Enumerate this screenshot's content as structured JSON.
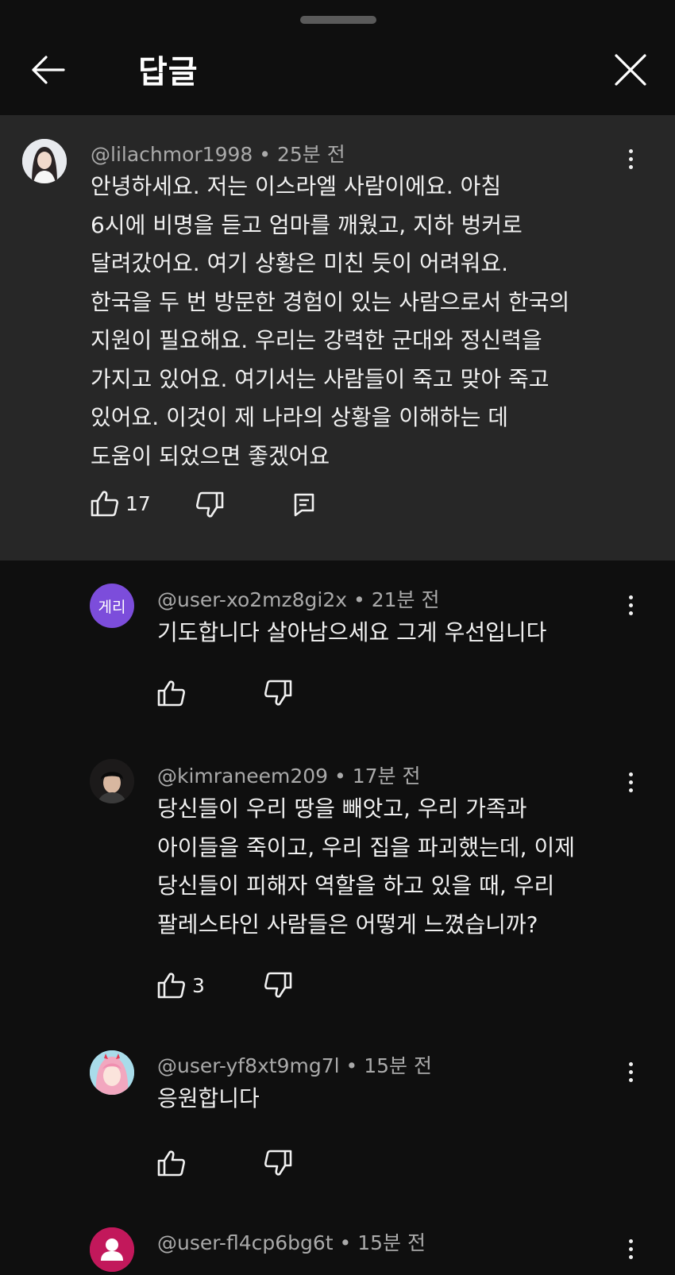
{
  "header": {
    "title": "답글",
    "back_icon": "arrow-left-icon",
    "close_icon": "close-icon"
  },
  "parent_comment": {
    "author": "@lilachmor1998",
    "time": "• 25분 전",
    "text": "안녕하세요. 저는 이스라엘 사람이에요. 아침\n6시에 비명을 듣고 엄마를 깨웠고, 지하 벙커로\n달려갔어요. 여기 상황은 미친 듯이 어려워요.\n한국을 두 번 방문한 경험이 있는 사람으로서 한국의\n지원이 필요해요. 우리는 강력한 군대와 정신력을\n가지고 있어요. 여기서는 사람들이 죽고 맞아 죽고\n있어요. 이것이 제 나라의 상황을 이해하는 데\n도움이 되었으면 좋겠어요",
    "likes": "17"
  },
  "replies": [
    {
      "author": "@user-xo2mz8gi2x",
      "time": "• 21분 전",
      "avatar_text": "게리",
      "avatar_color": "#7c4ddb",
      "text": "기도합니다 살아남으세요 그게 우선입니다",
      "likes": ""
    },
    {
      "author": "@kimraneem209",
      "time": "• 17분 전",
      "avatar_text": "",
      "text": "당신들이 우리 땅을 빼앗고, 우리 가족과\n아이들을 죽이고, 우리 집을 파괴했는데, 이제\n당신들이 피해자 역할을 하고 있을 때, 우리\n팔레스타인 사람들은 어떻게 느꼈습니까?",
      "likes": "3"
    },
    {
      "author": "@user-yf8xt9mg7l",
      "time": "• 15분 전",
      "avatar_text": "",
      "text": "응원합니다",
      "likes": ""
    },
    {
      "author": "@user-fl4cp6bg6t",
      "time": "• 15분 전",
      "avatar_text": "",
      "avatar_color": "#c2185b",
      "text": "",
      "likes": ""
    }
  ],
  "colors": {
    "background": "#0f0f0f",
    "highlight": "#272727",
    "meta_text": "#aaaaaa"
  }
}
